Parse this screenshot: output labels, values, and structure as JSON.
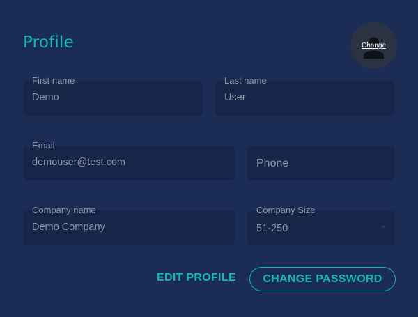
{
  "page": {
    "title": "Profile"
  },
  "avatar": {
    "change_label": "Change",
    "icon": "user-icon"
  },
  "form": {
    "first_name": {
      "label": "First name",
      "value": "Demo"
    },
    "last_name": {
      "label": "Last name",
      "value": "User"
    },
    "email": {
      "label": "Email",
      "value": "demouser@test.com"
    },
    "phone": {
      "placeholder": "Phone",
      "value": ""
    },
    "company_name": {
      "label": "Company name",
      "value": "Demo Company"
    },
    "company_size": {
      "label": "Company Size",
      "value": "51-250",
      "icon": "chevron-down-icon"
    }
  },
  "actions": {
    "edit_profile": "EDIT PROFILE",
    "change_password": "CHANGE PASSWORD"
  },
  "colors": {
    "accent": "#14b8b0",
    "background": "#1b2c55",
    "field_background": "#172648",
    "muted_text": "#8d96aa"
  }
}
